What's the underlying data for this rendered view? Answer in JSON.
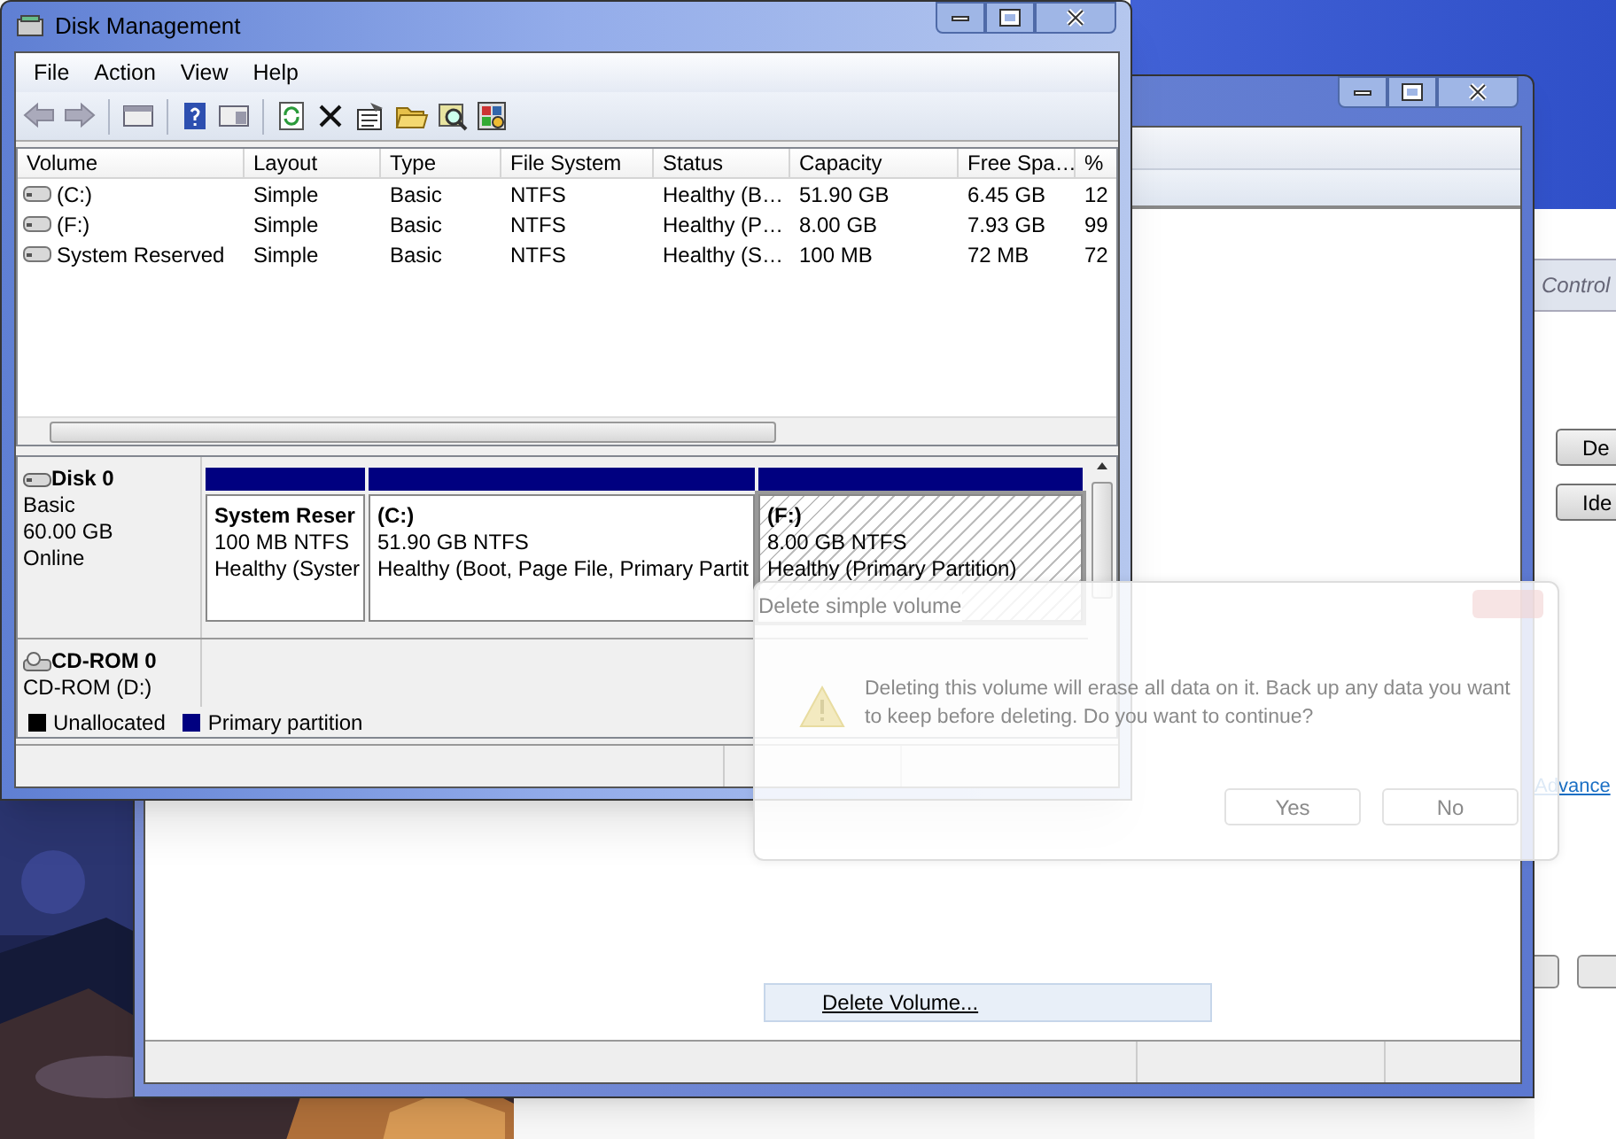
{
  "back_window": {
    "menu_item": {
      "label": "Delete Volume...",
      "selected": true
    }
  },
  "control_panel": {
    "breadcrumb": "Control",
    "buttons": [
      "De",
      "Ide"
    ],
    "link": "Advance"
  },
  "disk_management": {
    "title": "Disk Management",
    "menu": [
      "File",
      "Action",
      "View",
      "Help"
    ],
    "columns": [
      "Volume",
      "Layout",
      "Type",
      "File System",
      "Status",
      "Capacity",
      "Free Spa…",
      "%"
    ],
    "rows": [
      [
        "(C:)",
        "Simple",
        "Basic",
        "NTFS",
        "Healthy (B…",
        "51.90 GB",
        "6.45 GB",
        "12"
      ],
      [
        "(F:)",
        "Simple",
        "Basic",
        "NTFS",
        "Healthy (P…",
        "8.00 GB",
        "7.93 GB",
        "99"
      ],
      [
        "System Reserved",
        "Simple",
        "Basic",
        "NTFS",
        "Healthy (S…",
        "100 MB",
        "72 MB",
        "72"
      ]
    ],
    "disks": [
      {
        "kind": "disk",
        "name": "Disk 0",
        "lines": [
          "Basic",
          "60.00 GB",
          "Online"
        ],
        "partitions": [
          {
            "name": "System Reser",
            "size": "100 MB NTFS",
            "status": "Healthy (Syster",
            "selected": false
          },
          {
            "name": "(C:)",
            "size": "51.90 GB NTFS",
            "status": "Healthy (Boot, Page File, Primary Partit",
            "selected": false
          },
          {
            "name": "(F:)",
            "size": "8.00 GB NTFS",
            "status": "Healthy (Primary Partition)",
            "selected": true
          }
        ]
      },
      {
        "kind": "cdrom",
        "name": "CD-ROM 0",
        "lines": [
          "CD-ROM (D:)"
        ]
      }
    ],
    "legend": [
      {
        "label": "Unallocated",
        "color": "#000000"
      },
      {
        "label": "Primary partition",
        "color": "#000080"
      }
    ]
  },
  "dialog": {
    "title": "Delete simple volume",
    "message": "Deleting this volume will erase all data on it. Back up any data you want to keep before deleting. Do you want to continue?",
    "buttons": [
      "Yes",
      "No"
    ]
  }
}
